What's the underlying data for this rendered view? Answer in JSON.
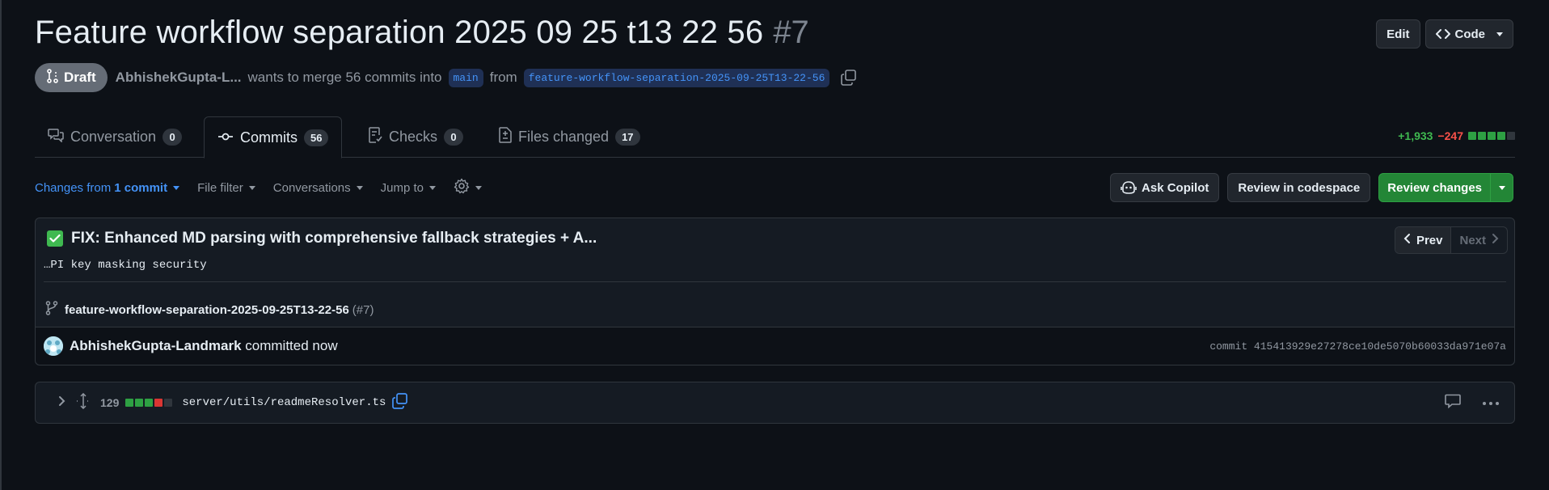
{
  "header": {
    "title": "Feature workflow separation 2025 09 25 t13 22 56",
    "number": "#7",
    "edit_label": "Edit",
    "code_label": "Code"
  },
  "meta": {
    "status": "Draft",
    "author": "AbhishekGupta-L...",
    "text": "wants to merge 56 commits into",
    "base_branch": "main",
    "from_text": "from",
    "head_branch": "feature-workflow-separation-2025-09-25T13-22-56"
  },
  "tabs": [
    {
      "label": "Conversation",
      "count": "0",
      "icon": "comment-discussion-icon"
    },
    {
      "label": "Commits",
      "count": "56",
      "icon": "git-commit-icon"
    },
    {
      "label": "Checks",
      "count": "0",
      "icon": "checklist-icon"
    },
    {
      "label": "Files changed",
      "count": "17",
      "icon": "file-diff-icon"
    }
  ],
  "diffstat": {
    "additions": "+1,933",
    "deletions": "−247",
    "blocks": [
      "#2ea043",
      "#2ea043",
      "#2ea043",
      "#2ea043",
      "#30363d"
    ]
  },
  "toolbar": {
    "changes_prefix": "Changes from",
    "changes_value": "1 commit",
    "file_filter": "File filter",
    "conversations": "Conversations",
    "jump_to": "Jump to",
    "ask_copilot": "Ask Copilot",
    "review_codespace": "Review in codespace",
    "review_changes": "Review changes"
  },
  "commit": {
    "title": "FIX: Enhanced MD parsing with comprehensive fallback strategies + A...",
    "body": "…PI key masking security",
    "prev": "Prev",
    "next": "Next",
    "branch": "feature-workflow-separation-2025-09-25T13-22-56",
    "branch_pr": "(#7)",
    "committer": "AbhishekGupta-Landmark",
    "committed_text": "committed now",
    "sha": "commit 415413929e27278ce10de5070b60033da971e07a"
  },
  "file": {
    "changes": "129",
    "path": "server/utils/readmeResolver.ts",
    "blocks": [
      "#2ea043",
      "#2ea043",
      "#2ea043",
      "#da3633",
      "#30363d"
    ]
  },
  "colors": {
    "background": "#0d1117",
    "accent": "#4493f8",
    "green": "#238636",
    "add": "#3fb950",
    "del": "#f85149"
  }
}
